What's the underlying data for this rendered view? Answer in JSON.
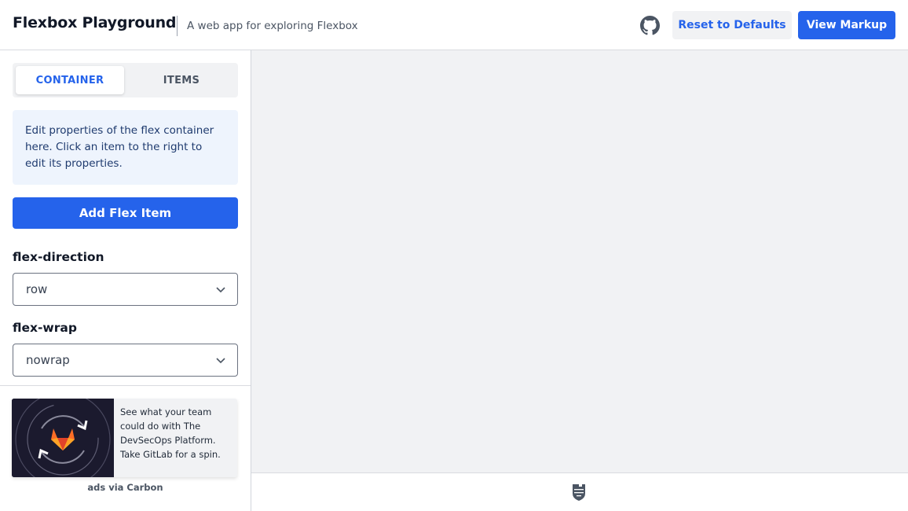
{
  "header": {
    "title": "Flexbox Playground",
    "subtitle": "A web app for exploring Flexbox",
    "github_icon": "github-icon",
    "reset_label": "Reset to Defaults",
    "view_markup_label": "View Markup"
  },
  "colors": {
    "accent": "#2563eb",
    "canvas_bg": "#f1f2f4",
    "info_bg": "#eef4fd"
  },
  "sidebar": {
    "tabs": [
      {
        "label": "CONTAINER",
        "active": true
      },
      {
        "label": "ITEMS",
        "active": false
      }
    ],
    "info_text": "Edit properties of the flex container here. Click an item to the right to edit its properties.",
    "add_item_label": "Add Flex Item",
    "fields": [
      {
        "label": "flex-direction",
        "value": "row"
      },
      {
        "label": "flex-wrap",
        "value": "nowrap"
      }
    ]
  },
  "ad": {
    "image_icon": "gitlab-logo-icon",
    "text": "See what your team could do with The DevSecOps Platform. Take GitLab for a spin.",
    "credit": "ads via Carbon"
  },
  "footer": {
    "logo_icon": "shield-logo-icon"
  }
}
